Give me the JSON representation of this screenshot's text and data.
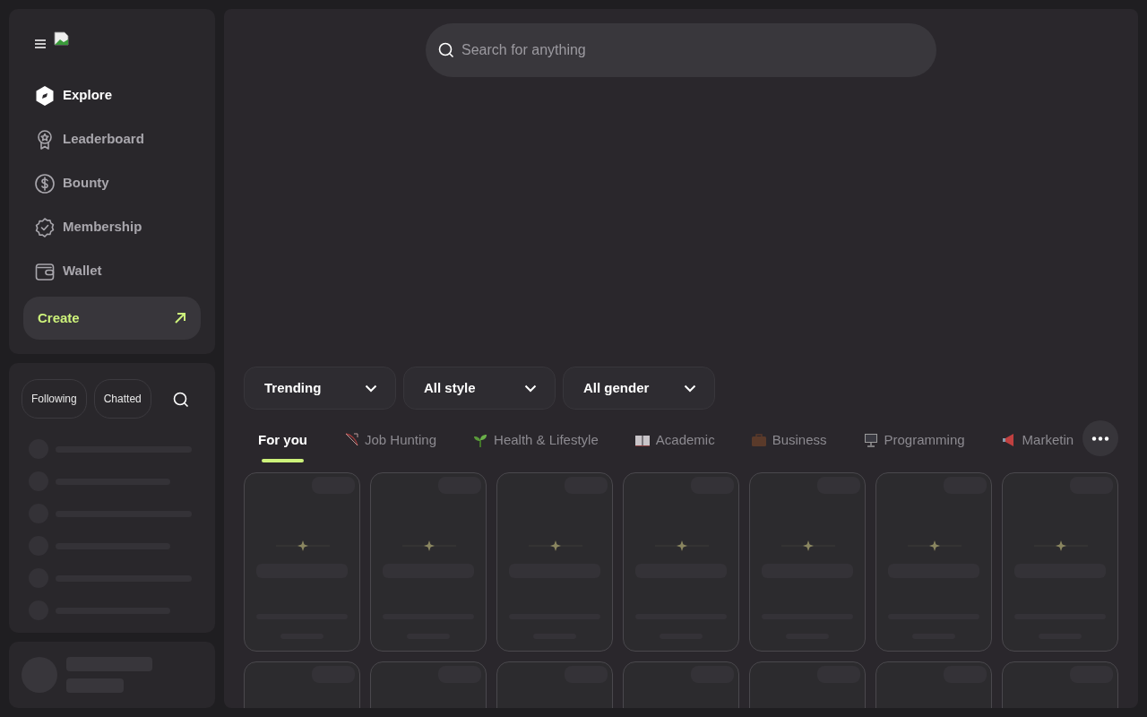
{
  "sidebar": {
    "nav": [
      {
        "label": "Explore",
        "selected": true
      },
      {
        "label": "Leaderboard",
        "selected": false
      },
      {
        "label": "Bounty",
        "selected": false
      },
      {
        "label": "Membership",
        "selected": false
      },
      {
        "label": "Wallet",
        "selected": false
      }
    ],
    "create_button": "Create",
    "chat_filters": [
      {
        "label": "Following",
        "selected": false
      },
      {
        "label": "Chatted",
        "selected": false
      }
    ]
  },
  "search": {
    "placeholder": "Search for anything"
  },
  "filters": [
    {
      "label": "Trending"
    },
    {
      "label": "All style"
    },
    {
      "label": "All gender"
    }
  ],
  "categories": [
    {
      "label": "For you",
      "selected": true
    },
    {
      "label": "Job Hunting",
      "selected": false
    },
    {
      "label": "Health & Lifestyle",
      "selected": false
    },
    {
      "label": "Academic",
      "selected": false
    },
    {
      "label": "Business",
      "selected": false
    },
    {
      "label": "Programming",
      "selected": false
    },
    {
      "label": "Marketin",
      "selected": false
    }
  ]
}
